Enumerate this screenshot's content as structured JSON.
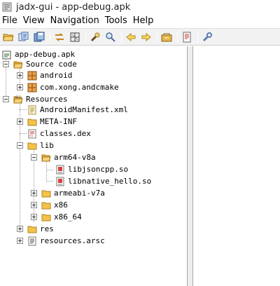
{
  "window": {
    "title": "jadx-gui - app-debug.apk"
  },
  "menu": [
    "File",
    "View",
    "Navigation",
    "Tools",
    "Help"
  ],
  "toolbar": {
    "buttons": [
      "open-file-icon",
      "open-project-icon",
      "save-all-icon",
      "sync-icon",
      "flatten-packages-icon",
      "search-icon",
      "find-class-icon",
      "back-icon",
      "forward-icon",
      "decompile-all-icon",
      "log-viewer-icon",
      "preferences-icon"
    ]
  },
  "tree": {
    "root": "app-debug.apk",
    "source_code": "Source code",
    "packages": [
      "android",
      "com.xong.andcmake"
    ],
    "resources": "Resources",
    "files": {
      "manifest": "AndroidManifest.xml",
      "meta_inf": "META-INF",
      "classes": "classes.dex",
      "lib": "lib",
      "arm64": "arm64-v8a",
      "so1": "libjsoncpp.so",
      "so2": "libnative_hello.so",
      "armeabi": "armeabi-v7a",
      "x86": "x86",
      "x86_64": "x86_64",
      "res": "res",
      "arsc": "resources.arsc"
    }
  },
  "colors": {
    "folder": "#f5c24a",
    "folder_dark": "#c98f1c",
    "package": "#d9822b",
    "selection": "#c5d9f1"
  }
}
